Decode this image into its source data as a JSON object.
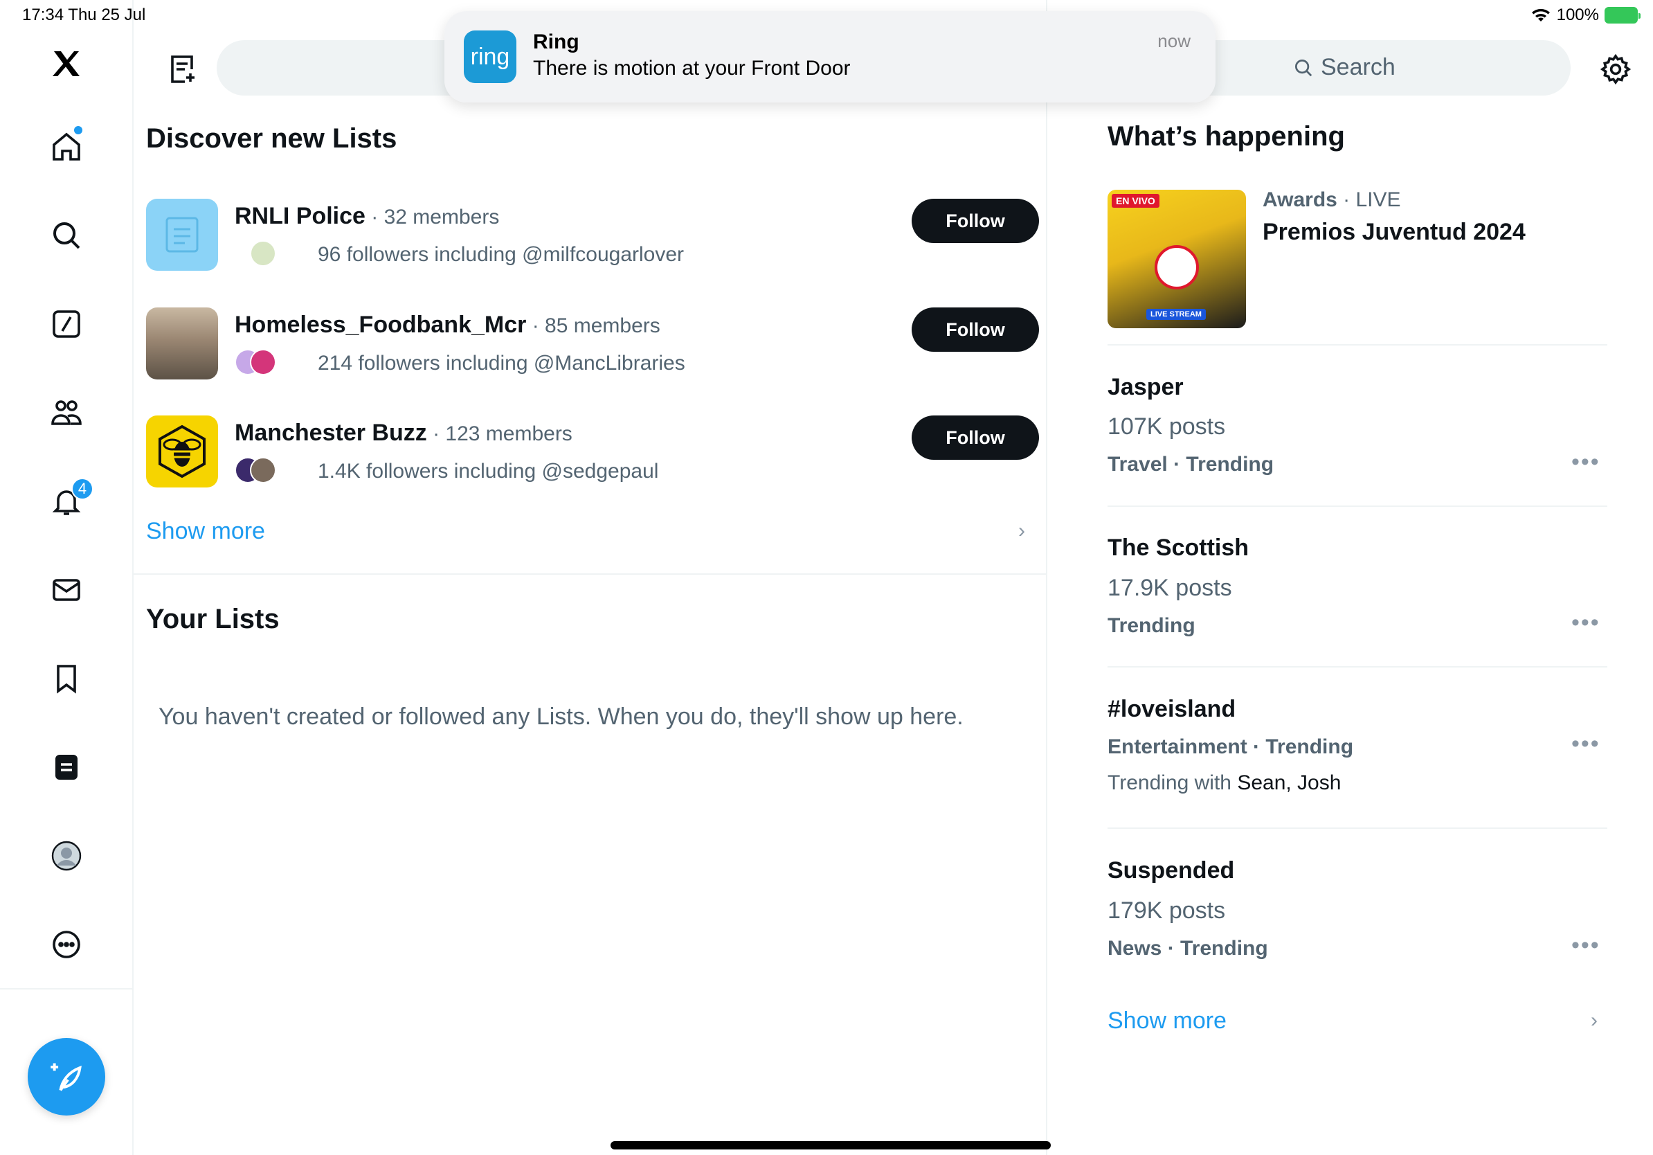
{
  "status_bar": {
    "time_date": "17:34   Thu 25 Jul",
    "battery": "100%"
  },
  "notification": {
    "app_icon_text": "ring",
    "app": "Ring",
    "message": "There is motion at your Front Door",
    "time": "now"
  },
  "search": {
    "label": "Search"
  },
  "nav": {
    "notification_count": "4"
  },
  "discover": {
    "title": "Discover new Lists",
    "lists": [
      {
        "name": "RNLI Police",
        "members": " · 32 members",
        "followers": "96 followers including @milfcougarlover",
        "follow_label": "Follow"
      },
      {
        "name": "Homeless_Foodbank_Mcr",
        "members": " · 85 members",
        "followers": "214 followers including @MancLibraries",
        "follow_label": "Follow"
      },
      {
        "name": "Manchester Buzz",
        "members": " · 123 members",
        "followers": "1.4K followers including @sedgepaul",
        "follow_label": "Follow"
      }
    ],
    "show_more": "Show more"
  },
  "your_lists": {
    "title": "Your Lists",
    "empty": "You haven't created or followed any Lists. When you do, they'll show up here."
  },
  "happening": {
    "title": "What’s happening",
    "featured": {
      "category": "Awards",
      "live": " · LIVE",
      "name": "Premios Juventud 2024",
      "thumb_tag": "EN VIVO",
      "thumb_badge": "LIVE STREAM"
    },
    "trends": [
      {
        "name": "Jasper",
        "posts": "107K posts",
        "category": "Travel · Trending",
        "with_prefix": "",
        "with_names": ""
      },
      {
        "name": "The Scottish",
        "posts": "17.9K posts",
        "category": "Trending",
        "with_prefix": "",
        "with_names": ""
      },
      {
        "name": "#loveisland",
        "posts": "",
        "category": "Entertainment · Trending",
        "with_prefix": "Trending with ",
        "with_names": "Sean, Josh"
      },
      {
        "name": "Suspended",
        "posts": "179K posts",
        "category": "News · Trending",
        "with_prefix": "",
        "with_names": ""
      }
    ],
    "show_more": "Show more"
  },
  "colors": {
    "accent": "#1d9bf0",
    "text": "#0f1419",
    "muted": "#536471",
    "divider": "#eff3f4"
  }
}
